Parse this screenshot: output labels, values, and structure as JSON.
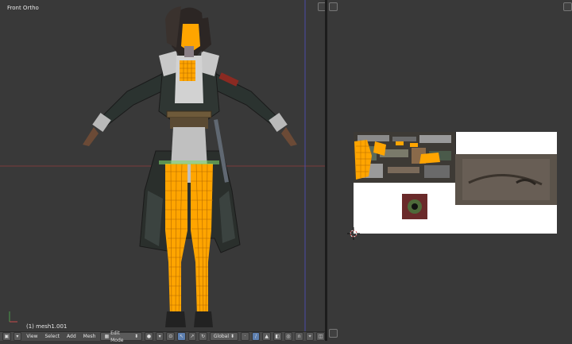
{
  "viewport": {
    "title": "Front Ortho",
    "object_label": "(1) mesh1.001"
  },
  "header": {
    "menus": [
      "View",
      "Select",
      "Add",
      "Mesh"
    ],
    "mode": "Edit Mode",
    "pivot": "Global"
  },
  "colors": {
    "background": "#393939",
    "grid_red": "#8b3a3a",
    "grid_blue": "#4a4a9a",
    "selection_orange": "#ffa500",
    "uv_white": "#ffffff"
  },
  "icons": [
    "editor-type-icon",
    "shading-sphere-icon",
    "manipulator-icon",
    "snap-magnet-icon",
    "render-icon"
  ]
}
